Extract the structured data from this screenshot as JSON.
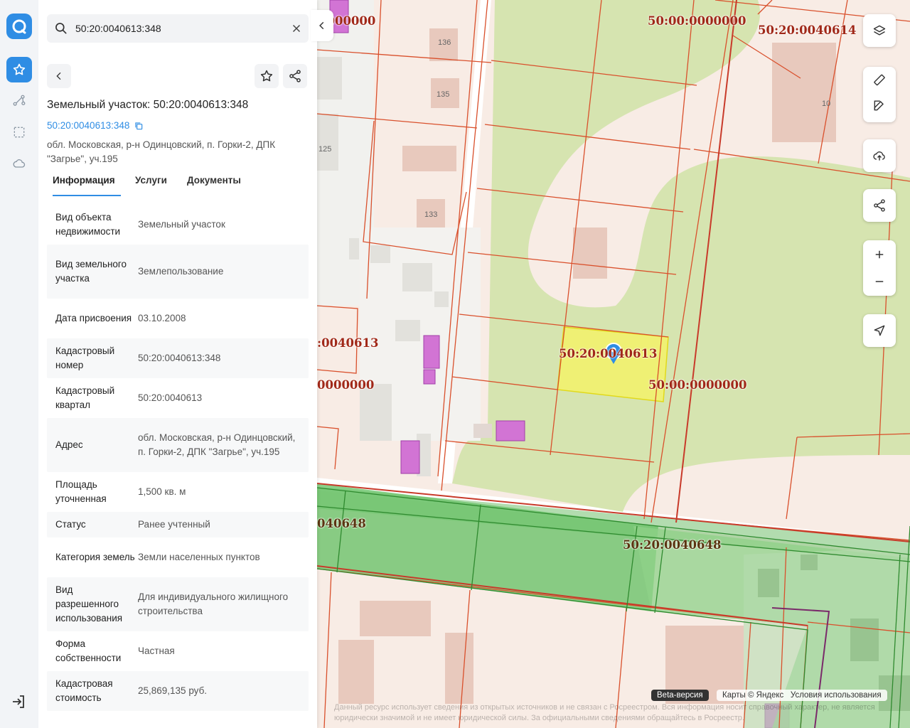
{
  "search": {
    "value": "50:20:0040613:348"
  },
  "panel": {
    "title": "Земельный участок: 50:20:0040613:348",
    "cad_link": "50:20:0040613:348",
    "address": "обл. Московская, р-н Одинцовский, п. Горки-2, ДПК \"Загрье\", уч.195",
    "tabs": [
      {
        "label": "Информация",
        "active": true
      },
      {
        "label": "Услуги",
        "active": false
      },
      {
        "label": "Документы",
        "active": false
      }
    ],
    "rows": [
      {
        "k": "Вид объекта недвижимости",
        "v": "Земельный участок"
      },
      {
        "k": "Вид земельного участка",
        "v": "Землепользование"
      },
      {
        "k": "Дата присвоения",
        "v": "03.10.2008"
      },
      {
        "k": "Кадастровый номер",
        "v": "50:20:0040613:348"
      },
      {
        "k": "Кадастровый квартал",
        "v": "50:20:0040613"
      },
      {
        "k": "Адрес",
        "v": "обл. Московская, р-н Одинцовский, п. Горки-2, ДПК \"Загрье\", уч.195"
      },
      {
        "k": "Площадь уточненная",
        "v": "1,500 кв. м"
      },
      {
        "k": "Статус",
        "v": "Ранее учтенный"
      },
      {
        "k": "Категория земель",
        "v": "Земли населенных пунктов"
      },
      {
        "k": "Вид разрешенного использования",
        "v": "Для индивидуального жилищного строительства"
      },
      {
        "k": "Форма собственности",
        "v": "Частная"
      },
      {
        "k": "Кадастровая стоимость",
        "v": "25,869,135 руб."
      }
    ]
  },
  "map": {
    "labels": {
      "l1": "0000000",
      "l2": "50:00:0000000",
      "l3": "50:20:0040614",
      "l4": ":0040613",
      "l5": "50:20:0040613",
      "l6": "50:00:0000000",
      "l7": "0000000",
      "l8": "040648",
      "l9": "50:20:0040648"
    },
    "houses": {
      "h136": "136",
      "h135": "135",
      "h125": "125",
      "h133": "133",
      "h10": "10"
    },
    "beta": "Beta-версия",
    "copyright": "Карты © Яндекс",
    "terms": "Условия использования",
    "disclaimer": "Данный ресурс использует сведения из открытых источников и не связан с Росреестром. Вся информация носит справочный характер, не является юридически значимой и не имеет юридической силы. За официальными сведениями обращайтесь в Росреестр."
  },
  "colors": {
    "accent": "#2f8de4",
    "parcel_line": "#d9502c",
    "selected": "#f4f36a",
    "green_zone": "#6cc36a"
  }
}
